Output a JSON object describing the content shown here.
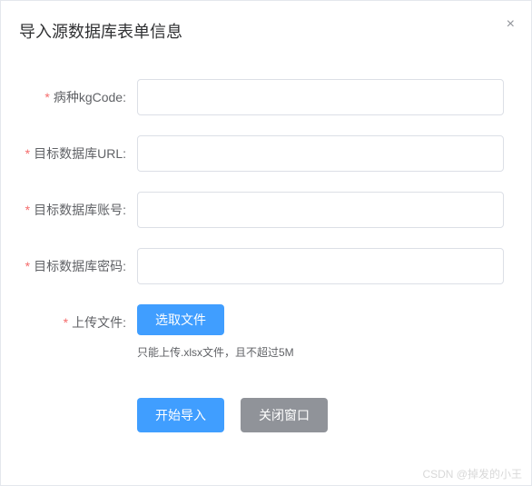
{
  "dialog": {
    "title": "导入源数据库表单信息",
    "close": "×"
  },
  "form": {
    "kgcode": {
      "label": "病种kgCode:",
      "value": ""
    },
    "url": {
      "label": "目标数据库URL:",
      "value": ""
    },
    "account": {
      "label": "目标数据库账号:",
      "value": ""
    },
    "password": {
      "label": "目标数据库密码:",
      "value": ""
    },
    "upload": {
      "label": "上传文件:",
      "button": "选取文件",
      "tip": "只能上传.xlsx文件，且不超过5M"
    }
  },
  "footer": {
    "submit": "开始导入",
    "close": "关闭窗口"
  },
  "required_mark": "*",
  "watermark": "CSDN @掉发的小王"
}
